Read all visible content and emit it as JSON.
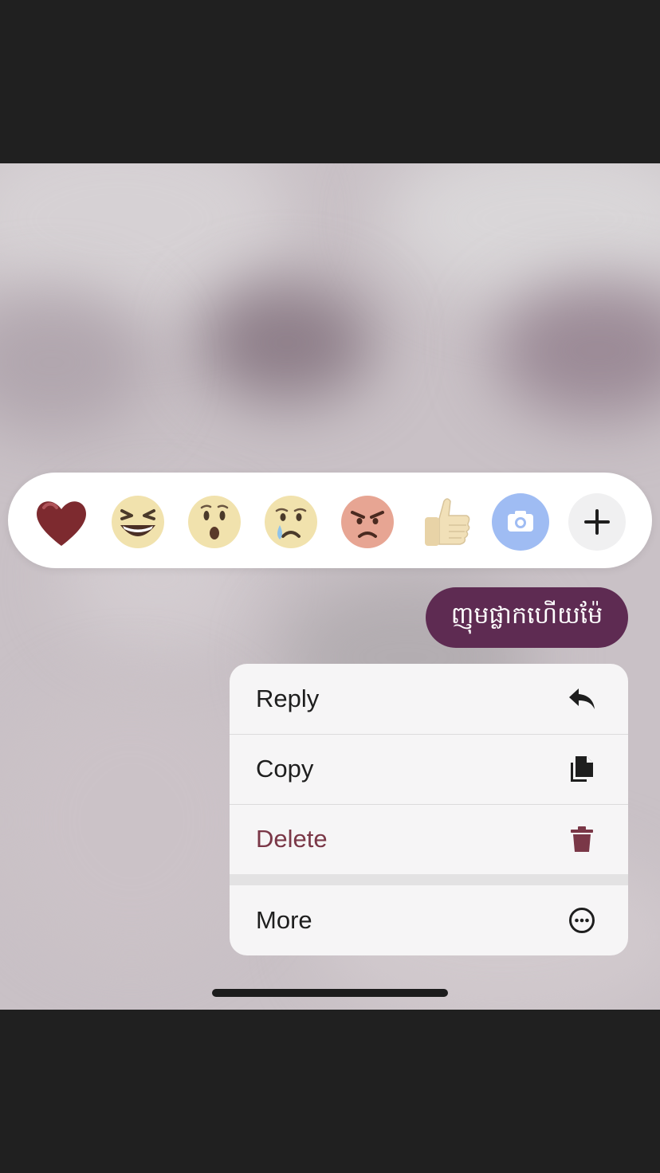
{
  "message": {
    "text": "ញុមផ្លាកហើយម៉ែ",
    "bubble_color": "#5e2b52"
  },
  "reactions": [
    {
      "name": "heart",
      "icon": "red-heart-icon"
    },
    {
      "name": "laughing",
      "icon": "grinning-squinting-face-icon"
    },
    {
      "name": "surprised",
      "icon": "hushed-face-icon"
    },
    {
      "name": "crying",
      "icon": "crying-face-icon"
    },
    {
      "name": "angry",
      "icon": "angry-face-icon"
    },
    {
      "name": "thumbs-up",
      "icon": "thumbs-up-icon"
    },
    {
      "name": "camera",
      "icon": "camera-icon"
    },
    {
      "name": "add",
      "icon": "plus-icon"
    }
  ],
  "menu": {
    "reply_label": "Reply",
    "copy_label": "Copy",
    "delete_label": "Delete",
    "more_label": "More",
    "delete_color": "#7a3747"
  }
}
